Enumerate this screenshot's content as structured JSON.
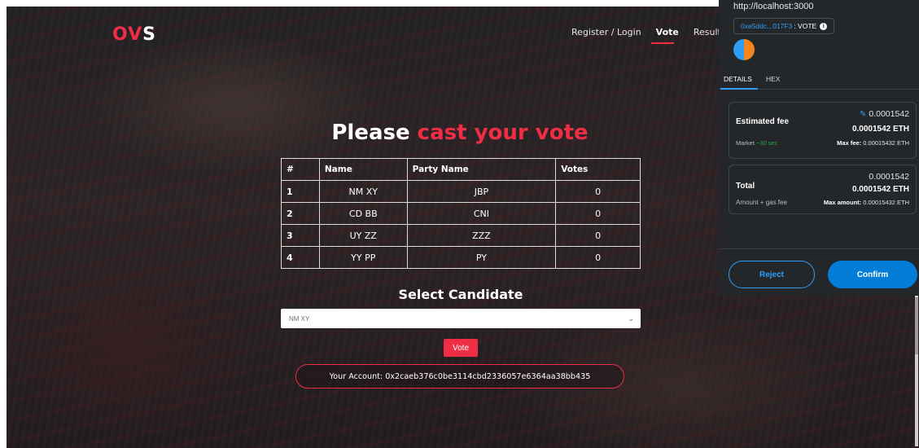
{
  "app": {
    "logo": {
      "part1": "OV",
      "part2": "S"
    },
    "nav": {
      "register_login": "Register / Login",
      "vote": "Vote",
      "results": "Results"
    }
  },
  "main": {
    "heading_plain": "Please",
    "heading_accent": "cast your vote",
    "table": {
      "headers": [
        "#",
        "Name",
        "Party Name",
        "Votes"
      ],
      "rows": [
        {
          "idx": "1",
          "name": "NM XY",
          "party": "JBP",
          "votes": "0"
        },
        {
          "idx": "2",
          "name": "CD BB",
          "party": "CNI",
          "votes": "0"
        },
        {
          "idx": "3",
          "name": "UY ZZ",
          "party": "ZZZ",
          "votes": "0"
        },
        {
          "idx": "4",
          "name": "YY PP",
          "party": "PY",
          "votes": "0"
        }
      ]
    },
    "select_title": "Select Candidate",
    "select_value": "NM XY",
    "vote_button": "Vote",
    "account_text": "Your Account: 0x2caeb376c0be3114cbd2336057e6364aa38bb435"
  },
  "wallet": {
    "url": "http://localhost:3000",
    "address": "0xe5ddc...017F3",
    "method": ": VOTE",
    "info_icon_glyph": "i",
    "tabs": [
      "DETAILS",
      "HEX"
    ],
    "fee": {
      "label": "Estimated fee",
      "sub_prefix": "Market",
      "sub_time": "~30 sec",
      "value": "0.0001542",
      "value_eth": "0.0001542 ETH",
      "max_label": "Max fee:",
      "max_value": "0.00015432 ETH"
    },
    "total": {
      "label": "Total",
      "sub": "Amount + gas fee",
      "value": "0.0001542",
      "value_eth": "0.0001542 ETH",
      "max_label": "Max amount:",
      "max_value": "0.00015432 ETH"
    },
    "reject": "Reject",
    "confirm": "Confirm"
  },
  "colors": {
    "accent_red": "#ef2e45",
    "wallet_bg": "#24272a",
    "wallet_blue": "#2f9df6"
  }
}
